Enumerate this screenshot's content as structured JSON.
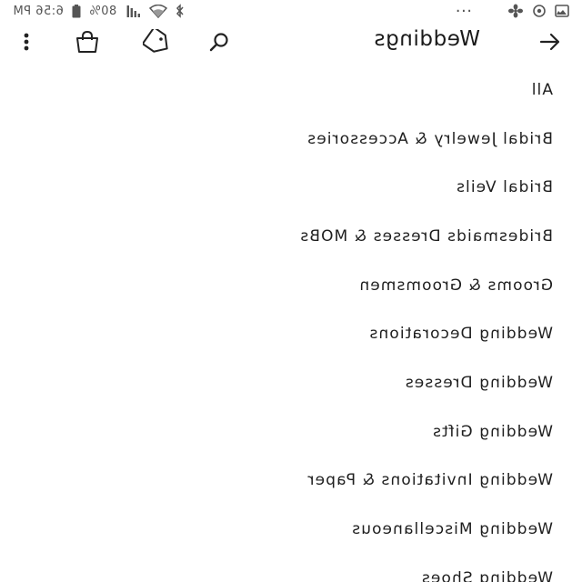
{
  "status_bar": {
    "time": "6:56 PM",
    "battery_percent": "80%",
    "overflow_dots": "···"
  },
  "app_bar": {
    "title": "Weddings",
    "icons": {
      "back": "arrow-back-icon",
      "search": "search-icon",
      "tag": "tag-icon",
      "bag": "shopping-bag-icon",
      "more": "more-vert-icon"
    }
  },
  "categories": [
    {
      "label": "All"
    },
    {
      "label": "Bridal Jewelry & Accessories"
    },
    {
      "label": "Bridal Veils"
    },
    {
      "label": "Bridesmaids Dresses & MOBs"
    },
    {
      "label": "Grooms & Groomsmen"
    },
    {
      "label": "Wedding Decorations"
    },
    {
      "label": "Wedding Dresses"
    },
    {
      "label": "Wedding Gifts"
    },
    {
      "label": "Wedding Invitations & Paper"
    },
    {
      "label": "Wedding Miscellaneous"
    },
    {
      "label": "Wedding Shoes"
    }
  ],
  "colors": {
    "background": "#ffffff",
    "text": "#1e1e1e",
    "status_text": "#555555"
  }
}
